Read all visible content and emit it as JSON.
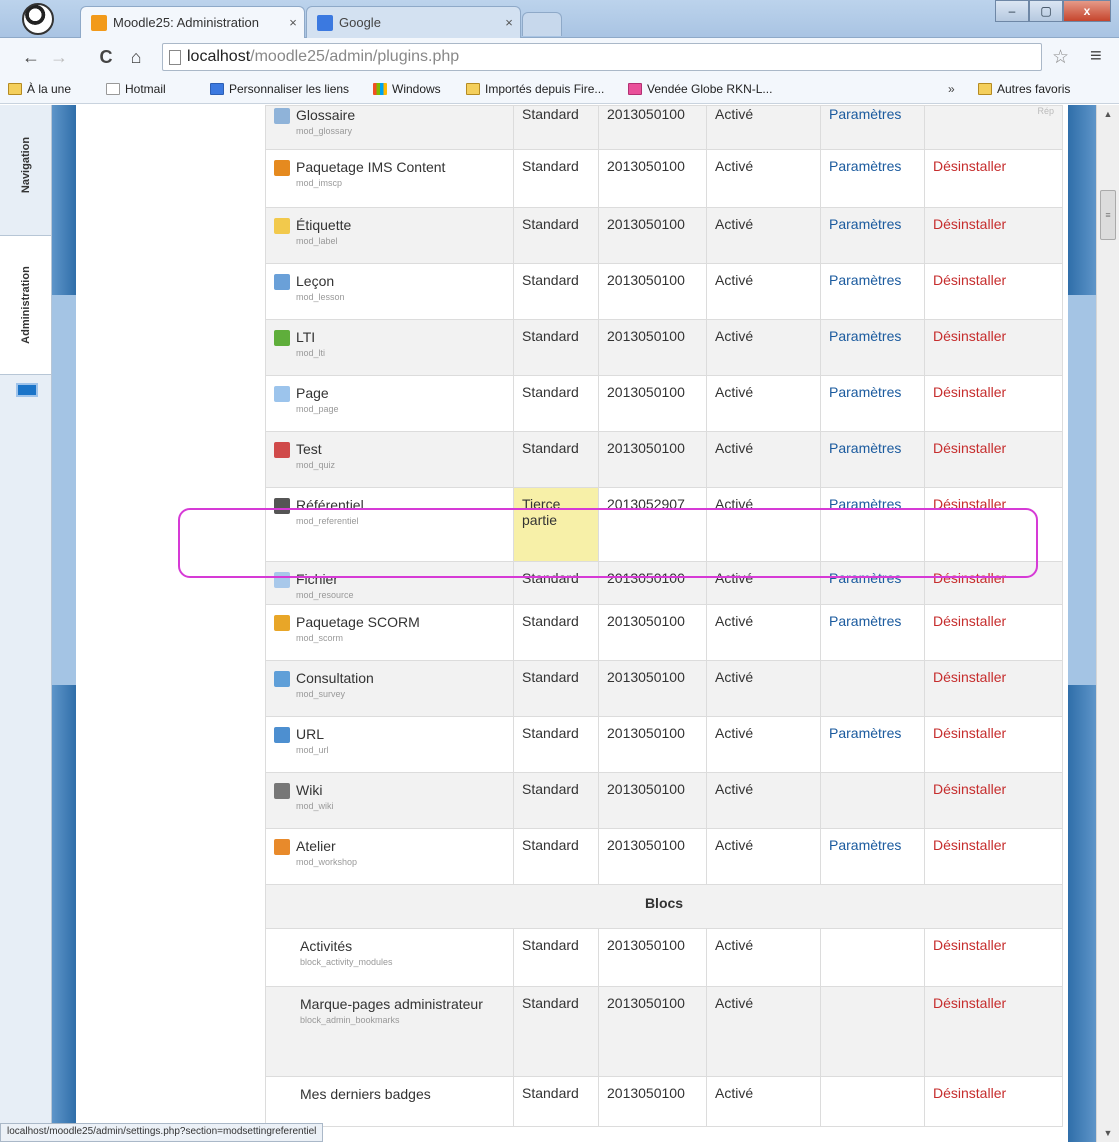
{
  "browser": {
    "tabs": [
      {
        "label": "Moodle25: Administration",
        "close": "×"
      },
      {
        "label": "Google",
        "close": "×"
      }
    ],
    "window_controls": {
      "minimize": "–",
      "maximize": "▢",
      "close": "x"
    },
    "nav": {
      "back": "←",
      "forward": "→",
      "reload": "C",
      "home": "⌂"
    },
    "url_host": "localhost",
    "url_path": "/moodle25/admin/plugins.php",
    "star": "☆",
    "menu": "≡",
    "bookmarks": [
      {
        "label": "À la une"
      },
      {
        "label": "Hotmail"
      },
      {
        "label": "Personnaliser les liens"
      },
      {
        "label": "Windows"
      },
      {
        "label": "Importés depuis Fire..."
      },
      {
        "label": "Vendée Globe RKN-L..."
      }
    ],
    "bookmarks_more": "»",
    "other_bookmarks": "Autres favoris",
    "status_url": "localhost/moodle25/admin/settings.php?section=modsettingreferentiel"
  },
  "dock": {
    "navigation": "Navigation",
    "administration": "Administration"
  },
  "scrollbar": {
    "up": "▲",
    "down": "▼",
    "grip": "≡"
  },
  "plugins_table": {
    "glossary_help": "Rép",
    "rows": [
      {
        "name": "Glossaire",
        "code": "mod_glossary",
        "source": "Standard",
        "version": "2013050100",
        "status": "Activé",
        "settings": "Paramètres",
        "uninstall": ""
      },
      {
        "name": "Paquetage IMS Content",
        "code": "mod_imscp",
        "source": "Standard",
        "version": "2013050100",
        "status": "Activé",
        "settings": "Paramètres",
        "uninstall": "Désinstaller"
      },
      {
        "name": "Étiquette",
        "code": "mod_label",
        "source": "Standard",
        "version": "2013050100",
        "status": "Activé",
        "settings": "Paramètres",
        "uninstall": "Désinstaller"
      },
      {
        "name": "Leçon",
        "code": "mod_lesson",
        "source": "Standard",
        "version": "2013050100",
        "status": "Activé",
        "settings": "Paramètres",
        "uninstall": "Désinstaller"
      },
      {
        "name": "LTI",
        "code": "mod_lti",
        "source": "Standard",
        "version": "2013050100",
        "status": "Activé",
        "settings": "Paramètres",
        "uninstall": "Désinstaller"
      },
      {
        "name": "Page",
        "code": "mod_page",
        "source": "Standard",
        "version": "2013050100",
        "status": "Activé",
        "settings": "Paramètres",
        "uninstall": "Désinstaller"
      },
      {
        "name": "Test",
        "code": "mod_quiz",
        "source": "Standard",
        "version": "2013050100",
        "status": "Activé",
        "settings": "Paramètres",
        "uninstall": "Désinstaller"
      },
      {
        "name": "Référentiel",
        "code": "mod_referentiel",
        "source": "Tierce partie",
        "version": "2013052907",
        "status": "Activé",
        "settings": "Paramètres",
        "uninstall": "Désinstaller"
      },
      {
        "name": "Fichier",
        "code": "mod_resource",
        "source": "Standard",
        "version": "2013050100",
        "status": "Activé",
        "settings": "Paramètres",
        "uninstall": "Désinstaller"
      },
      {
        "name": "Paquetage SCORM",
        "code": "mod_scorm",
        "source": "Standard",
        "version": "2013050100",
        "status": "Activé",
        "settings": "Paramètres",
        "uninstall": "Désinstaller"
      },
      {
        "name": "Consultation",
        "code": "mod_survey",
        "source": "Standard",
        "version": "2013050100",
        "status": "Activé",
        "settings": "",
        "uninstall": "Désinstaller"
      },
      {
        "name": "URL",
        "code": "mod_url",
        "source": "Standard",
        "version": "2013050100",
        "status": "Activé",
        "settings": "Paramètres",
        "uninstall": "Désinstaller"
      },
      {
        "name": "Wiki",
        "code": "mod_wiki",
        "source": "Standard",
        "version": "2013050100",
        "status": "Activé",
        "settings": "",
        "uninstall": "Désinstaller"
      },
      {
        "name": "Atelier",
        "code": "mod_workshop",
        "source": "Standard",
        "version": "2013050100",
        "status": "Activé",
        "settings": "Paramètres",
        "uninstall": "Désinstaller"
      }
    ],
    "section_blocks": "Blocs",
    "block_rows": [
      {
        "name": "Activités",
        "code": "block_activity_modules",
        "source": "Standard",
        "version": "2013050100",
        "status": "Activé",
        "settings": "",
        "uninstall": "Désinstaller"
      },
      {
        "name": "Marque-pages administrateur",
        "code": "block_admin_bookmarks",
        "source": "Standard",
        "version": "2013050100",
        "status": "Activé",
        "settings": "",
        "uninstall": "Désinstaller"
      },
      {
        "name": "Mes derniers badges",
        "code": "",
        "source": "Standard",
        "version": "2013050100",
        "status": "Activé",
        "settings": "",
        "uninstall": "Désinstaller"
      }
    ]
  },
  "icon_colors": {
    "moodle": "#f29a1a",
    "google": "#3b79e0",
    "glossary": "#8fb3d9",
    "imscp": "#e58a1f",
    "label": "#f2c94c",
    "lesson": "#6aa0d8",
    "lti": "#5fae3b",
    "page": "#9cc4ec",
    "quiz": "#d04a4a",
    "referentiel": "#555555",
    "resource": "#a8c8ea",
    "scorm": "#e8a628",
    "survey": "#5f9fd8",
    "url": "#4d8fd0",
    "wiki": "#777777",
    "workshop": "#e88a2b"
  },
  "highlight_color": "#d63ad6"
}
